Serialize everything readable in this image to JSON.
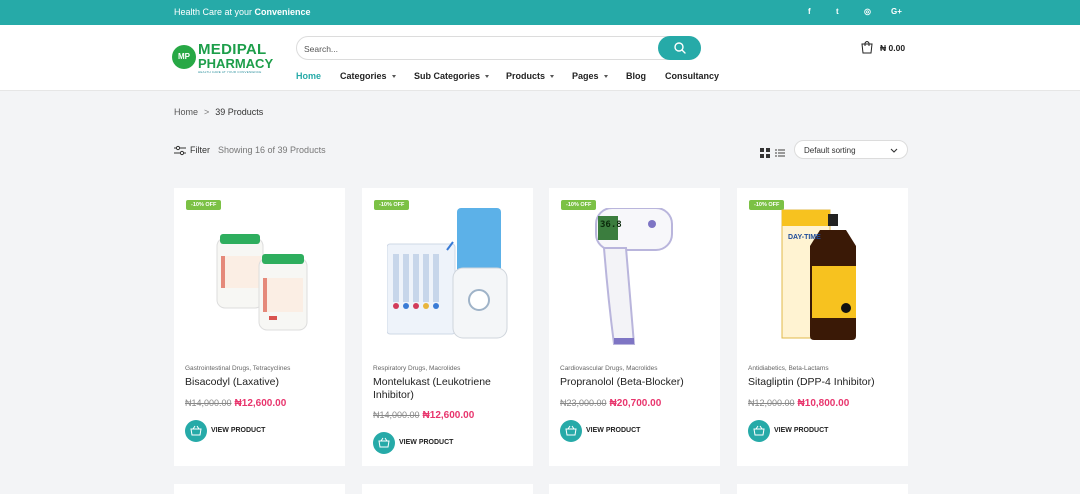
{
  "topbar": {
    "tagline_prefix": "Health Care at your ",
    "tagline_bold": "Convenience",
    "social": [
      {
        "icon": "facebook-icon",
        "glyph": "f"
      },
      {
        "icon": "twitter-icon",
        "glyph": "t"
      },
      {
        "icon": "instagram-icon",
        "glyph": "◎"
      },
      {
        "icon": "google-plus-icon",
        "glyph": "G+"
      }
    ]
  },
  "logo": {
    "mark": "MP",
    "line1": "MEDIPAL",
    "line2": "PHARMACY",
    "line3": "HEALTH CARE AT YOUR CONVENIENCE"
  },
  "search": {
    "placeholder": "Search..."
  },
  "nav": [
    {
      "label": "Home",
      "active": true,
      "dropdown": false
    },
    {
      "label": "Categories",
      "active": false,
      "dropdown": true
    },
    {
      "label": "Sub Categories",
      "active": false,
      "dropdown": true
    },
    {
      "label": "Products",
      "active": false,
      "dropdown": true
    },
    {
      "label": "Pages",
      "active": false,
      "dropdown": true
    },
    {
      "label": "Blog",
      "active": false,
      "dropdown": false
    },
    {
      "label": "Consultancy",
      "active": false,
      "dropdown": false
    }
  ],
  "cart": {
    "amount": "₦ 0.00",
    "icon": "shopping-bag-icon"
  },
  "breadcrumb": {
    "home": "Home",
    "separator": ">",
    "current": "39 Products"
  },
  "toolbar": {
    "filter_label": "Filter",
    "showing_text": "Showing 16 of 39 Products",
    "sort_selected": "Default sorting"
  },
  "products": [
    {
      "badge": "-10% OFF",
      "categories": "Gastrointestinal Drugs, Tetracyclines",
      "name": "Bisacodyl (Laxative)",
      "old_price": "₦14,000.00",
      "new_price": "₦12,600.00",
      "button": "VIEW PRODUCT",
      "image": "supplement-jars-image"
    },
    {
      "badge": "-10% OFF",
      "categories": "Respiratory Drugs, Macrolides",
      "name": "Montelukast (Leukotriene Inhibitor)",
      "old_price": "₦14,000.00",
      "new_price": "₦12,600.00",
      "button": "VIEW PRODUCT",
      "image": "water-flosser-image"
    },
    {
      "badge": "-10% OFF",
      "categories": "Cardiovascular Drugs, Macrolides",
      "name": "Propranolol (Beta-Blocker)",
      "old_price": "₦23,000.00",
      "new_price": "₦20,700.00",
      "button": "VIEW PRODUCT",
      "image": "thermometer-image",
      "thermometer_reading": "36.8"
    },
    {
      "badge": "-10% OFF",
      "categories": "Antidiabetics, Beta-Lactams",
      "name": "Sitagliptin (DPP-4 Inhibitor)",
      "old_price": "₦12,000.00",
      "new_price": "₦10,800.00",
      "button": "VIEW PRODUCT",
      "image": "syrup-bottle-image",
      "box_text": "DAY-TIME"
    }
  ],
  "colors": {
    "brand_teal": "#26aaa8",
    "brand_green": "#1d9e4a",
    "sale_pink": "#e8356d",
    "badge_green": "#7bc145"
  }
}
